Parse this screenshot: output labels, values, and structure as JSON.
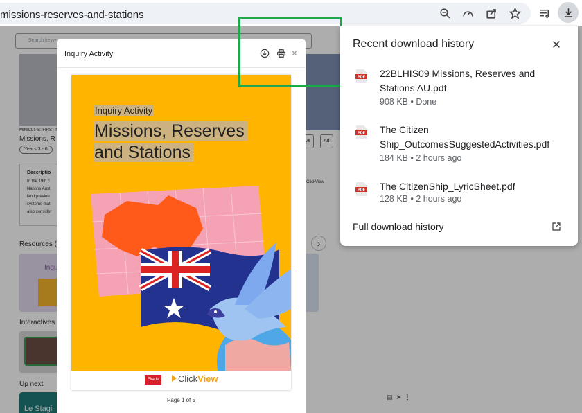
{
  "browser": {
    "url_text": "missions-reserves-and-stations",
    "toolbar_icons": [
      "zoom-out-icon",
      "performance-icon",
      "share-icon",
      "bookmark-star-icon",
      "reading-list-icon",
      "download-icon"
    ]
  },
  "page": {
    "search_placeholder": "Search keyw",
    "miniclips_label": "MINICLIPS: FIRST N",
    "title_partial": "Missions, R",
    "year_pill": "Years 3 - 6",
    "description_heading": "Descriptio",
    "description_lines": [
      "In the 19th c",
      "Nations Aust",
      "land previou",
      "systems that",
      "also consider"
    ],
    "resources_heading": "Resources (",
    "resource_card_text": "Inqu",
    "interactives_heading": "Interactives",
    "up_next_heading": "Up next",
    "up_next_card_text": "Le Stagi",
    "right_button_1": "ve",
    "right_button_2": "Ad",
    "clickview_small": "ClickView"
  },
  "modal": {
    "title": "Inquiry Activity",
    "cover": {
      "kicker": "Inquiry Activity",
      "title_line1": "Missions, Reserves",
      "title_line2": "and Stations",
      "logo_text": "Eliade",
      "brand_click": "Click",
      "brand_view": "View"
    },
    "page_indicator": "Page 1 of 5",
    "colors": {
      "cover_yellow": "#ffb400",
      "cover_highlight": "#cbb280"
    }
  },
  "downloads": {
    "title": "Recent download history",
    "items": [
      {
        "name": "22BLHIS09 Missions, Reserves and Stations AU.pdf",
        "meta": "908 KB • Done",
        "icon": "pdf-icon"
      },
      {
        "name": "The Citizen Ship_OutcomesSuggestedActivities.pdf",
        "meta": "184 KB • 2 hours ago",
        "icon": "pdf-icon"
      },
      {
        "name": "The CitizenShip_LyricSheet.pdf",
        "meta": "128 KB • 2 hours ago",
        "icon": "pdf-icon"
      }
    ],
    "full_history_label": "Full download history",
    "pdf_label": "PDF"
  },
  "highlight_color": "#1aaa4a"
}
